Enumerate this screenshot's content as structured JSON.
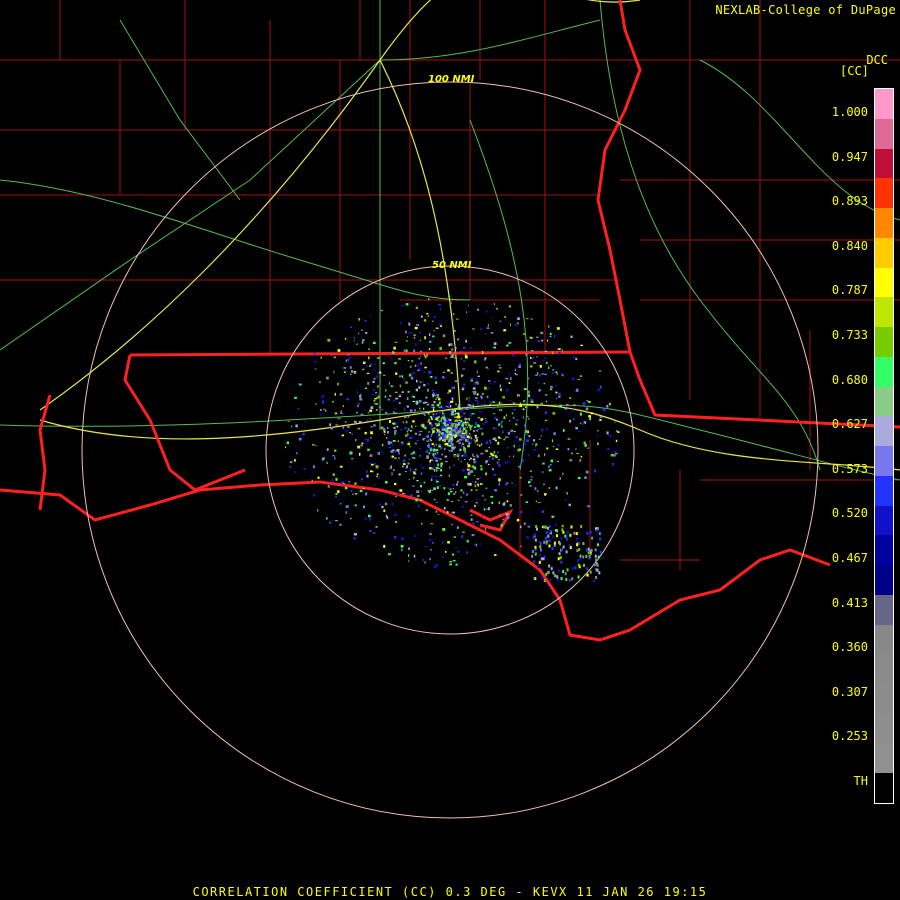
{
  "credit": "NEXLAB-College of DuPage",
  "site": "DCC",
  "units": "[CC]",
  "rings": [
    "100 NMI",
    "50 NMI"
  ],
  "legend": {
    "ticks": [
      "1.000",
      "0.947",
      "0.893",
      "0.840",
      "0.787",
      "0.733",
      "0.680",
      "0.627",
      "0.573",
      "0.520",
      "0.467",
      "0.413",
      "0.360",
      "0.307",
      "0.253",
      "TH"
    ],
    "colors": [
      "#ff99cc",
      "#e06a95",
      "#c0103a",
      "#ff3300",
      "#ff8800",
      "#ffcc00",
      "#ffff00",
      "#bfe600",
      "#77cc00",
      "#33ff66",
      "#88cc88",
      "#aaaadd",
      "#7777ee",
      "#2233ff",
      "#1111cc",
      "#0000a0",
      "#000088",
      "#666688",
      "#888888",
      "#8a8a8a",
      "#8c8c8c",
      "#8e8e8e",
      "#909090",
      "#000000"
    ]
  },
  "footer": "CORRELATION COEFFICIENT (CC) 0.3 DEG - KEVX 11 JAN 26 19:15",
  "colors": {
    "state_border": "#ff2020",
    "county_border": "#b01010",
    "highway_major": "#e6e64d",
    "highway_minor": "#66cc66",
    "range_ring": "#f0c0b0"
  }
}
